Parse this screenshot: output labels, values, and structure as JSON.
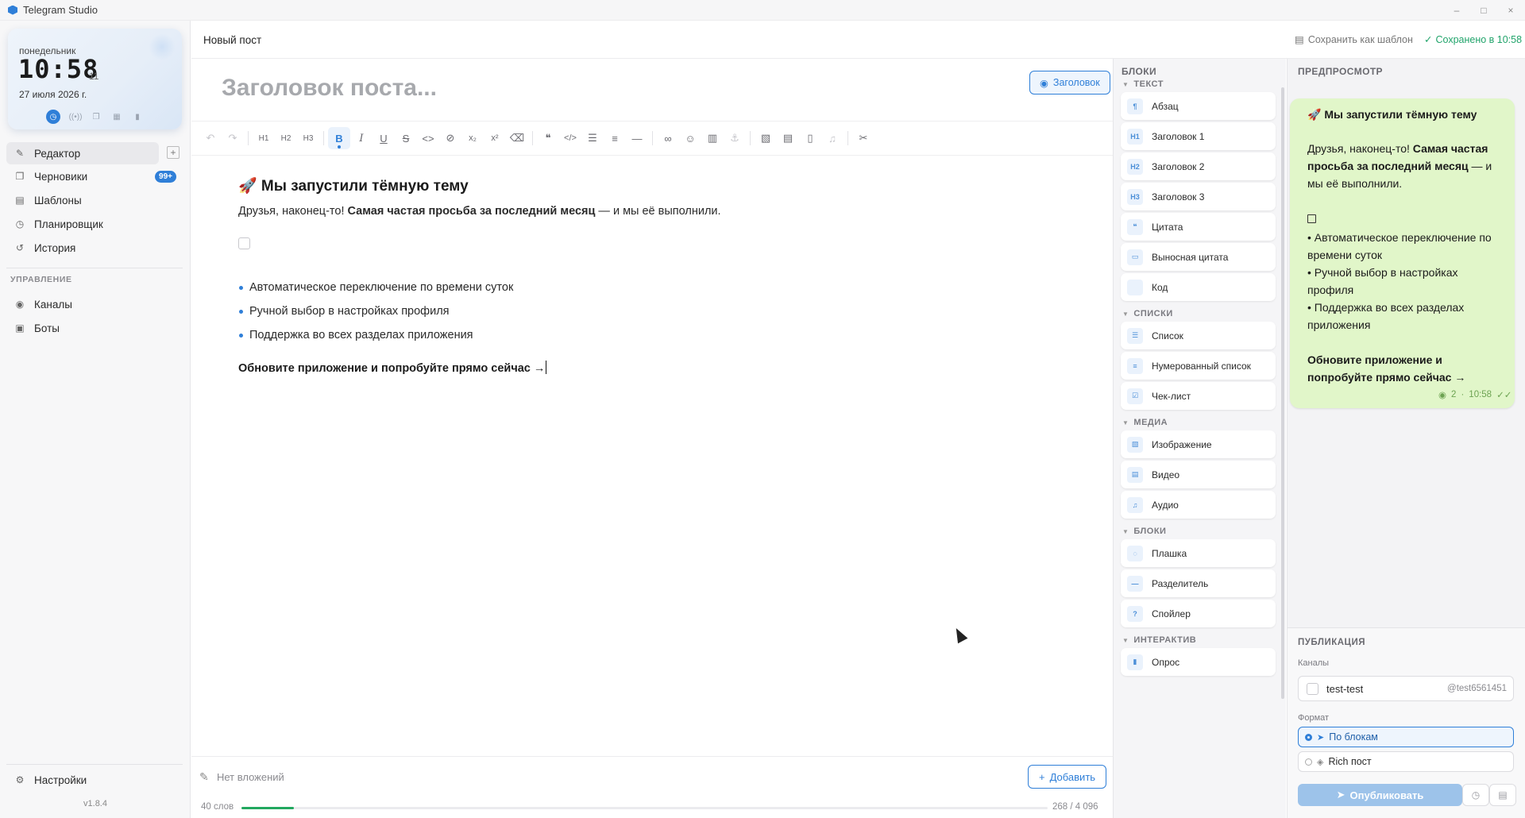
{
  "window": {
    "title": "Telegram Studio",
    "minimize": "–",
    "maximize": "□",
    "close": "×"
  },
  "clock": {
    "day": "понедельник",
    "time": "10:58",
    "seconds": "11",
    "date": "27 июля 2026 г."
  },
  "sidebar": {
    "items": [
      {
        "label": "Редактор"
      },
      {
        "label": "Черновики",
        "badge": "99+"
      },
      {
        "label": "Шаблоны"
      },
      {
        "label": "Планировщик"
      },
      {
        "label": "История"
      }
    ],
    "section_manage": "УПРАВЛЕНИЕ",
    "manage_items": [
      {
        "label": "Каналы"
      },
      {
        "label": "Боты"
      }
    ],
    "settings": "Настройки",
    "version": "v1.8.4"
  },
  "header": {
    "title": "Новый пост",
    "save_template": "Сохранить как шаблон",
    "saved": "Сохранено в 10:58"
  },
  "editor": {
    "title_placeholder": "Заголовок поста...",
    "header_toggle": "Заголовок",
    "heading": "🚀 Мы запустили тёмную тему",
    "intro_plain": "Друзья, наконец-то! ",
    "intro_bold": "Самая частая просьба за последний месяц",
    "intro_tail": " — и мы её выполнили.",
    "bullets": [
      "Автоматическое переключение по времени суток",
      "Ручной выбор в настройках профиля",
      "Поддержка во всех разделах приложения"
    ],
    "cta": "Обновите приложение и попробуйте прямо сейчас →"
  },
  "toolbar": {
    "buttons": [
      "undo",
      "redo",
      "h1",
      "h2",
      "h3",
      "bold",
      "italic",
      "underline",
      "strikethrough",
      "code",
      "spoiler",
      "subscript",
      "superscript",
      "clear-format",
      "quote",
      "code-block",
      "bullet-list",
      "numbered-list",
      "divider",
      "link",
      "emoji",
      "clipboard",
      "anchor",
      "image",
      "video",
      "file",
      "audio",
      "cut"
    ],
    "h1": "H1",
    "h2": "H2",
    "h3": "H3"
  },
  "attachments": {
    "none": "Нет вложений",
    "add": "Добавить"
  },
  "status": {
    "words": "40 слов",
    "chars": "268 / 4 096",
    "progress": 0.065
  },
  "blocks": {
    "title": "БЛОКИ",
    "groups": [
      {
        "name": "ТЕКСТ",
        "items": [
          "Абзац",
          "Заголовок 1",
          "Заголовок 2",
          "Заголовок 3",
          "Цитата",
          "Выносная цитата",
          "Код"
        ]
      },
      {
        "name": "СПИСКИ",
        "items": [
          "Список",
          "Нумерованный список",
          "Чек-лист"
        ]
      },
      {
        "name": "МЕДИА",
        "items": [
          "Изображение",
          "Видео",
          "Аудио"
        ]
      },
      {
        "name": "БЛОКИ",
        "items": [
          "Плашка",
          "Разделитель",
          "Спойлер"
        ]
      },
      {
        "name": "ИНТЕРАКТИВ",
        "items": [
          "Опрос"
        ]
      }
    ]
  },
  "preview": {
    "title": "ПРЕДПРОСМОТР",
    "lines": {
      "heading": "🚀 Мы запустили тёмную тему",
      "l1a": "Друзья, наконец-то! ",
      "l1b": "Самая частая",
      "l2a": "просьба за последний месяц",
      "l2b": " — и",
      "l3": "мы её выполнили.",
      "b1a": "• Автоматическое переключение по",
      "b1b": "времени суток",
      "b2a": "• Ручной выбор в настройках",
      "b2b": "профиля",
      "b3a": "• Поддержка во всех разделах",
      "b3b": "приложения",
      "c1": "Обновите приложение и",
      "c2": "попробуйте прямо сейчас →"
    },
    "views": "2",
    "time": "10:58"
  },
  "publish": {
    "title": "ПУБЛИКАЦИЯ",
    "channels_label": "Каналы",
    "channel_name": "test-test",
    "channel_handle": "@test6561451",
    "format_label": "Формат",
    "format_blocks": "По блокам",
    "format_rich": "Rich пост",
    "publish": "Опубликовать"
  },
  "colors": {
    "accent": "#2f7fd8",
    "success": "#21a46b",
    "bubble": "#e1f6c9"
  }
}
